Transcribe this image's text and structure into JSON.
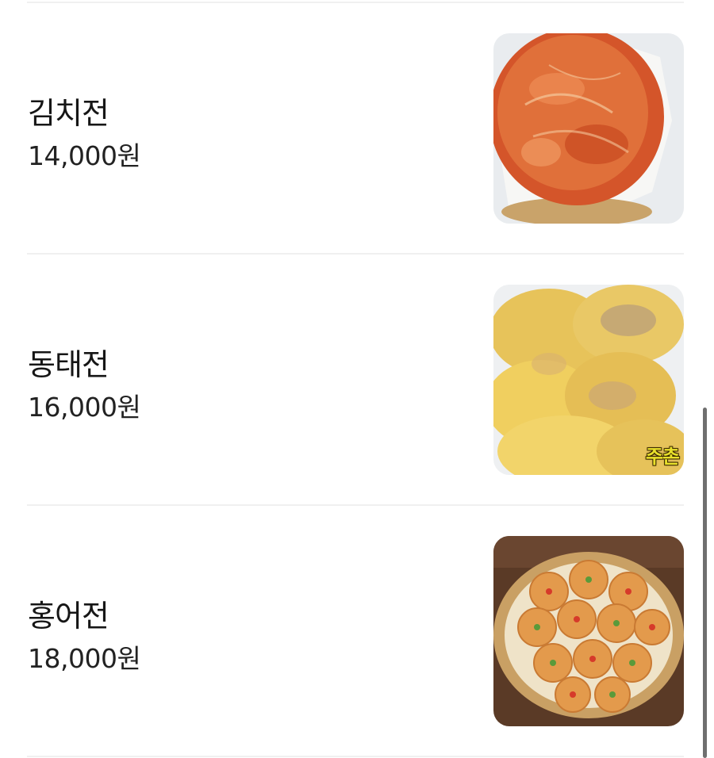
{
  "menu": {
    "items": [
      {
        "name": "김치전",
        "price": "14,000원",
        "image_icon": "kimchi-pancake-photo"
      },
      {
        "name": "동태전",
        "price": "16,000원",
        "image_icon": "pollock-pancake-photo",
        "image_caption": "주촌"
      },
      {
        "name": "홍어전",
        "price": "18,000원",
        "image_icon": "skate-pancake-photo"
      }
    ]
  },
  "colors": {
    "text": "#161616",
    "divider": "#f0f0f0",
    "scrollbar": "#6f6f6f",
    "caption_yellow": "#e8e02a"
  }
}
